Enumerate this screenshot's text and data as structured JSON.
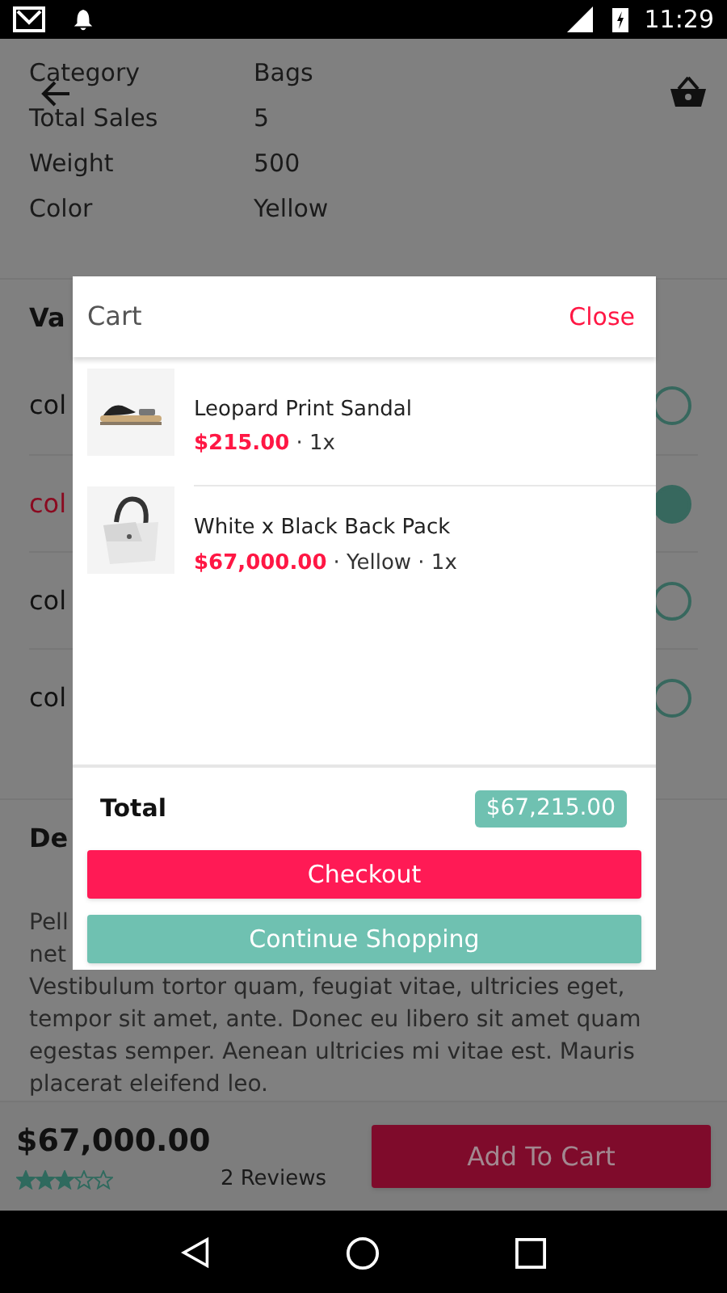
{
  "status_bar": {
    "time": "11:29"
  },
  "details": [
    {
      "label": "Category",
      "value": "Bags"
    },
    {
      "label": "Total Sales",
      "value": "5"
    },
    {
      "label": "Weight",
      "value": "500"
    },
    {
      "label": "Color",
      "value": "Yellow"
    }
  ],
  "variants": {
    "heading": "Va",
    "options": [
      {
        "label": "col",
        "selected": false
      },
      {
        "label": "col",
        "selected": true
      },
      {
        "label": "col",
        "selected": false
      },
      {
        "label": "col",
        "selected": false
      }
    ]
  },
  "description": {
    "heading": "De",
    "lines": [
      "Pell",
      "net",
      "Vestibulum tortor quam, feugiat vitae, ultricies eget,",
      "tempor sit amet, ante. Donec eu libero sit amet quam",
      "egestas semper. Aenean ultricies mi vitae est. Mauris",
      "placerat eleifend leo."
    ]
  },
  "bottom_bar": {
    "price": "$67,000.00",
    "stars": 3,
    "reviews": "2 Reviews",
    "add_button": "Add To Cart"
  },
  "cart": {
    "title": "Cart",
    "close": "Close",
    "items": [
      {
        "name": "Leopard Print Sandal",
        "price": "$215.00",
        "details": "· 1x"
      },
      {
        "name": "White x Black Back Pack",
        "price": "$67,000.00",
        "details": "· Yellow · 1x"
      }
    ],
    "total_label": "Total",
    "total": "$67,215.00",
    "checkout": "Checkout",
    "continue": "Continue Shopping"
  }
}
